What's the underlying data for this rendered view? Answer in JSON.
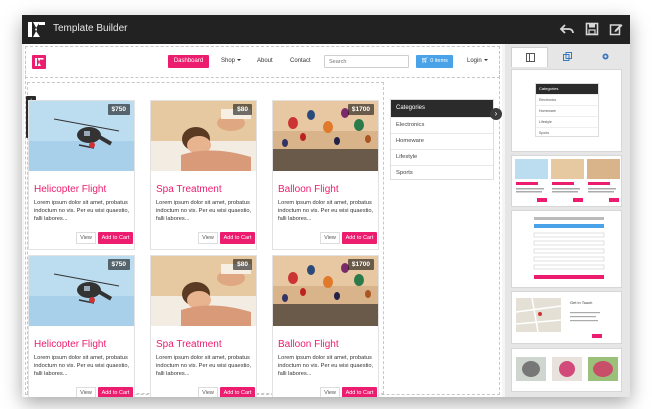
{
  "app": {
    "title": "Template Builder"
  },
  "toolbar": {
    "undo_icon": "undo-icon",
    "save_icon": "save-icon",
    "edit_icon": "edit-icon"
  },
  "navbar": {
    "dashboard_label": "Dashboard",
    "shop_label": "Shop",
    "about_label": "About",
    "contact_label": "Contact",
    "search_placeholder": "Search",
    "cart_label": "0 items",
    "login_label": "Login"
  },
  "products": [
    {
      "title": "Helicopter Flight",
      "price": "$750",
      "description": "Lorem ipsum dolor sit amet, probatus indoctum no vis. Per eu wisi quaestio, falli labores...",
      "view_label": "View",
      "cart_label": "Add to Cart"
    },
    {
      "title": "Spa Treatment",
      "price": "$80",
      "description": "Lorem ipsum dolor sit amet, probatus indoctum no vis. Per eu wisi quaestio, falli labores...",
      "view_label": "View",
      "cart_label": "Add to Cart"
    },
    {
      "title": "Balloon Flight",
      "price": "$1700",
      "description": "Lorem ipsum dolor sit amet, probatus indoctum no vis. Per eu wisi quaestio, falli labores...",
      "view_label": "View",
      "cart_label": "Add to Cart"
    },
    {
      "title": "Helicopter Flight",
      "price": "$750",
      "description": "Lorem ipsum dolor sit amet, probatus indoctum no vis. Per eu wisi quaestio, falli labores...",
      "view_label": "View",
      "cart_label": "Add to Cart"
    },
    {
      "title": "Spa Treatment",
      "price": "$80",
      "description": "Lorem ipsum dolor sit amet, probatus indoctum no vis. Per eu wisi quaestio, falli labores...",
      "view_label": "View",
      "cart_label": "Add to Cart"
    },
    {
      "title": "Balloon Flight",
      "price": "$1700",
      "description": "Lorem ipsum dolor sit amet, probatus indoctum no vis. Per eu wisi quaestio, falli labores...",
      "view_label": "View",
      "cart_label": "Add to Cart"
    }
  ],
  "categories": {
    "heading": "Categories",
    "items": [
      "Electronics",
      "Homeware",
      "Lifestyle",
      "Sports"
    ]
  },
  "panel": {
    "tabs": [
      "layout-icon",
      "copy-icon",
      "settings-icon"
    ],
    "thumb_categories": {
      "heading": "Categories",
      "items": [
        "Electronics",
        "Homeware",
        "Lifestyle",
        "Sports"
      ]
    },
    "thumb_contact_heading": "Get in Touch"
  },
  "colors": {
    "accent": "#ec1d6e",
    "titlebar": "#222222",
    "cart_button": "#4aa3e8"
  }
}
